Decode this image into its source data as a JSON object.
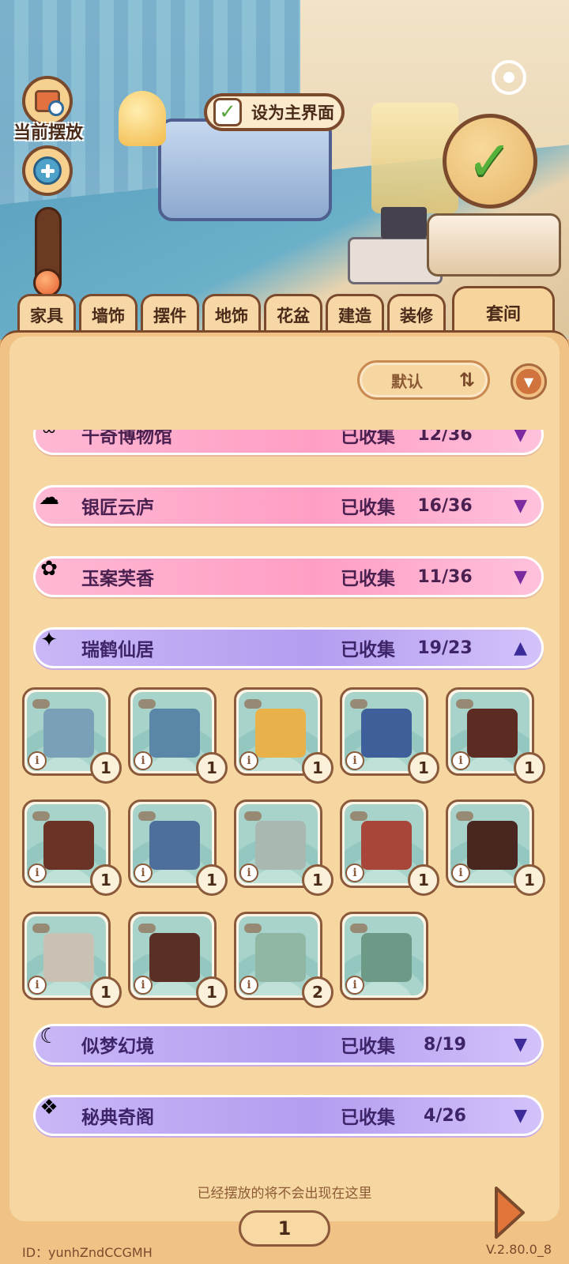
{
  "scene": {
    "placed_label": "当前摆放",
    "set_main_label": "设为主界面"
  },
  "tabs": [
    "家具",
    "墙饰",
    "摆件",
    "地饰",
    "花盆",
    "建造",
    "装修"
  ],
  "active_tab": "套间",
  "sort": {
    "label": "默认"
  },
  "suites": [
    {
      "name": "千奇博物馆",
      "collected_label": "已收集",
      "count": "12/36",
      "color": "pink",
      "expanded": false,
      "icon": "museum-icon"
    },
    {
      "name": "银匠云庐",
      "collected_label": "已收集",
      "count": "16/36",
      "color": "pink",
      "expanded": false,
      "icon": "silver-cloud-icon"
    },
    {
      "name": "玉案芙香",
      "collected_label": "已收集",
      "count": "11/36",
      "color": "pink",
      "expanded": false,
      "icon": "rose-icon"
    },
    {
      "name": "瑞鹤仙居",
      "collected_label": "已收集",
      "count": "19/23",
      "color": "purple",
      "expanded": true,
      "icon": "crane-icon"
    },
    {
      "name": "似梦幻境",
      "collected_label": "已收集",
      "count": "8/19",
      "color": "purple",
      "expanded": false,
      "icon": "moon-icon"
    },
    {
      "name": "秘典奇阁",
      "collected_label": "已收集",
      "count": "4/26",
      "color": "purple",
      "expanded": false,
      "icon": "book-icon"
    }
  ],
  "items": [
    {
      "name": "crane-rug",
      "qty": "1",
      "color": "#7aa0b8"
    },
    {
      "name": "crane-staff",
      "qty": "1",
      "color": "#5a87a8"
    },
    {
      "name": "gold-fish-bowl",
      "qty": "1",
      "color": "#e8b14a"
    },
    {
      "name": "blue-incense-burner",
      "qty": "1",
      "color": "#3f5f9a"
    },
    {
      "name": "rosewood-stand",
      "qty": "1",
      "color": "#5c2c22"
    },
    {
      "name": "rosewood-chair",
      "qty": "1",
      "color": "#6a3326"
    },
    {
      "name": "lantern-stand",
      "qty": "1",
      "color": "#4e6f9a"
    },
    {
      "name": "folding-screen",
      "qty": "1",
      "color": "#a9b8b0"
    },
    {
      "name": "canopy-bed",
      "qty": "1",
      "color": "#a8463a"
    },
    {
      "name": "display-shelf",
      "qty": "1",
      "color": "#4a2620"
    },
    {
      "name": "crane-statue",
      "qty": "1",
      "color": "#c9c2b4"
    },
    {
      "name": "lattice-screen",
      "qty": "1",
      "color": "#5a2f26"
    },
    {
      "name": "painted-screen",
      "qty": "2",
      "color": "#8fb7a4"
    },
    {
      "name": "landscape-panel",
      "qty": "",
      "color": "#6c9a86"
    }
  ],
  "hint": "已经摆放的将不会出现在这里",
  "page": "1",
  "footer": {
    "id": "ID：yunhZndCCGMH",
    "version": "V.2.80.0_8"
  }
}
